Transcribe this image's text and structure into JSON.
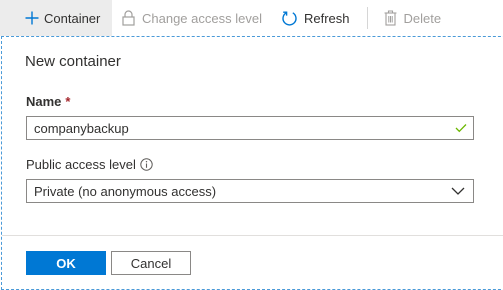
{
  "toolbar": {
    "container_label": "Container",
    "change_access_label": "Change access level",
    "refresh_label": "Refresh",
    "delete_label": "Delete"
  },
  "panel": {
    "title": "New container",
    "name_label": "Name",
    "required_marker": "*",
    "name_value": "companybackup",
    "public_access_label": "Public access level",
    "public_access_value": "Private (no anonymous access)"
  },
  "actions": {
    "ok_label": "OK",
    "cancel_label": "Cancel"
  },
  "colors": {
    "accent": "#0078d4",
    "valid_check": "#6bb700",
    "required": "#a4262c",
    "disabled_text": "#a19f9d"
  },
  "icons": {
    "container": "plus-icon",
    "change_access": "lock-icon",
    "refresh": "refresh-icon",
    "delete": "trash-icon",
    "info": "info-icon",
    "valid": "check-icon",
    "dropdown": "chevron-down-icon"
  }
}
